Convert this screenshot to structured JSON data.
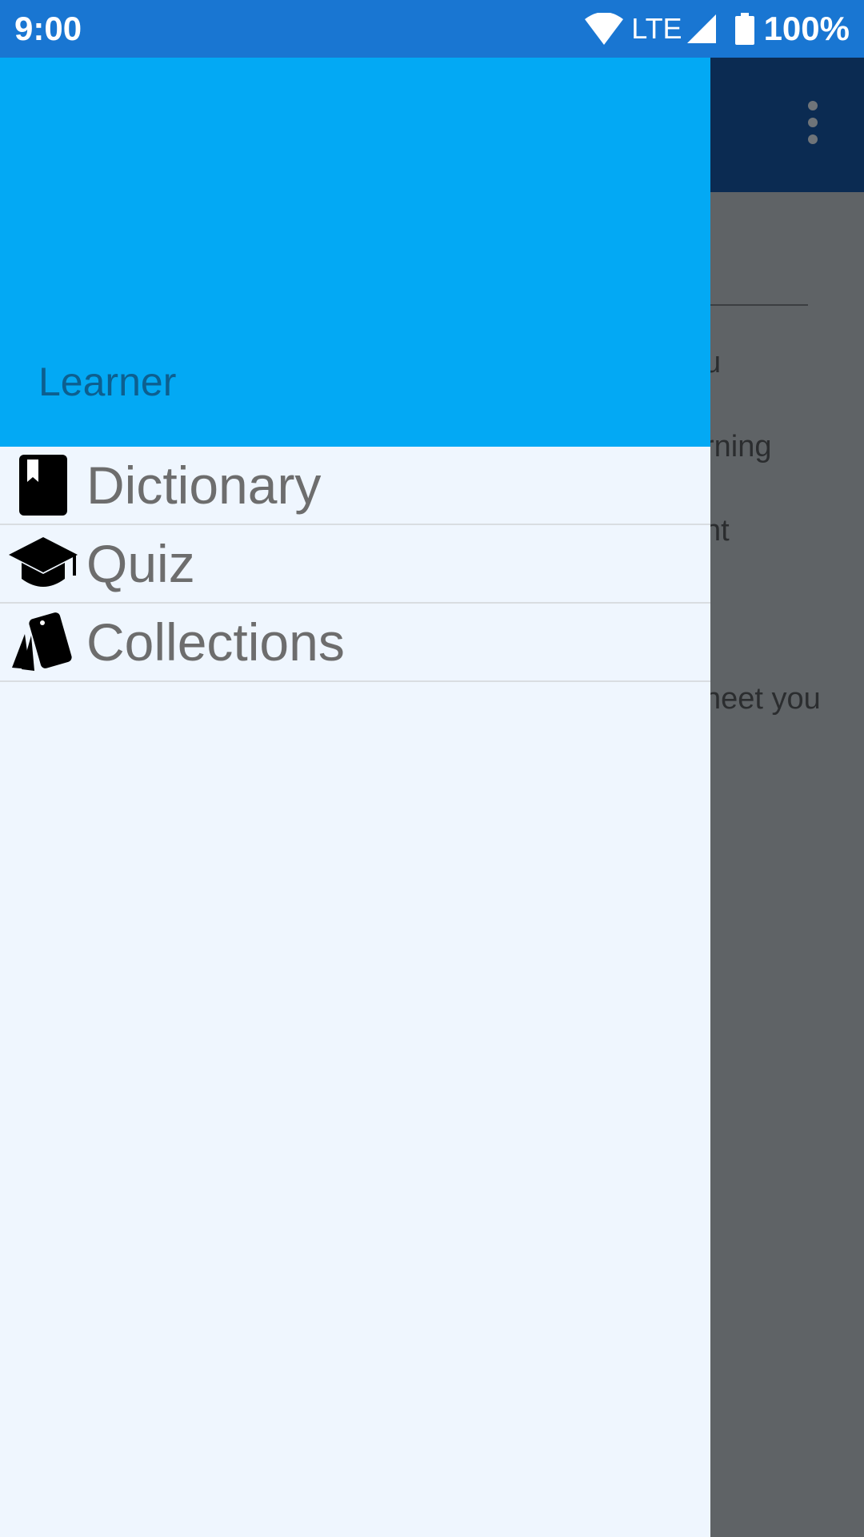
{
  "status_bar": {
    "time": "9:00",
    "network": "LTE",
    "battery": "100%"
  },
  "background": {
    "partial_lines": [
      "u",
      "rning",
      "ht",
      "neet you"
    ]
  },
  "drawer": {
    "header_color": "#03a9f4",
    "user_name": "Learner",
    "items": [
      {
        "label": "Dictionary",
        "icon": "book-icon"
      },
      {
        "label": "Quiz",
        "icon": "graduation-cap-icon"
      },
      {
        "label": "Collections",
        "icon": "cards-icon"
      }
    ]
  }
}
